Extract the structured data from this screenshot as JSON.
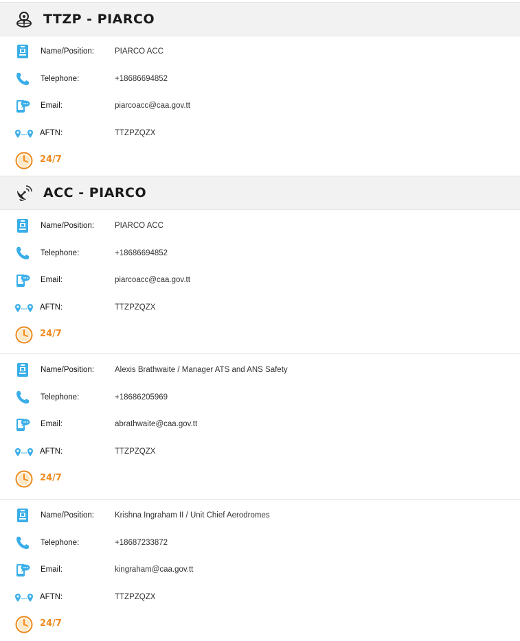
{
  "sections": [
    {
      "title": "TTZP - PIARCO",
      "icon": "globe-pin-icon",
      "contacts": [
        {
          "name_label": "Name/Position:",
          "name_value": "PIARCO ACC",
          "phone_label": "Telephone:",
          "phone_value": "+18686694852",
          "email_label": "Email:",
          "email_value": "piarcoacc@caa.gov.tt",
          "aftn_label": "AFTN:",
          "aftn_value": "TTZPZQZX",
          "hours": "24/7"
        }
      ]
    },
    {
      "title": "ACC - PIARCO",
      "icon": "satellite-dish-icon",
      "contacts": [
        {
          "name_label": "Name/Position:",
          "name_value": "PIARCO ACC",
          "phone_label": "Telephone:",
          "phone_value": "+18686694852",
          "email_label": "Email:",
          "email_value": "piarcoacc@caa.gov.tt",
          "aftn_label": "AFTN:",
          "aftn_value": "TTZPZQZX",
          "hours": "24/7"
        },
        {
          "name_label": "Name/Position:",
          "name_value": "Alexis Brathwaite / Manager ATS and ANS Safety",
          "phone_label": "Telephone:",
          "phone_value": "+18686205969",
          "email_label": "Email:",
          "email_value": "abrathwaite@caa.gov.tt",
          "aftn_label": "AFTN:",
          "aftn_value": "TTZPZQZX",
          "hours": "24/7"
        },
        {
          "name_label": "Name/Position:",
          "name_value": "Krishna Ingraham II / Unit Chief Aerodromes",
          "phone_label": "Telephone:",
          "phone_value": "+18687233872",
          "email_label": "Email:",
          "email_value": "kingraham@caa.gov.tt",
          "aftn_label": "AFTN:",
          "aftn_value": "TTZPZQZX",
          "hours": "24/7"
        }
      ]
    }
  ],
  "colors": {
    "icon_blue": "#3aaee8",
    "hours_orange": "#ee8a1e",
    "header_bg": "#f2f2f2"
  }
}
